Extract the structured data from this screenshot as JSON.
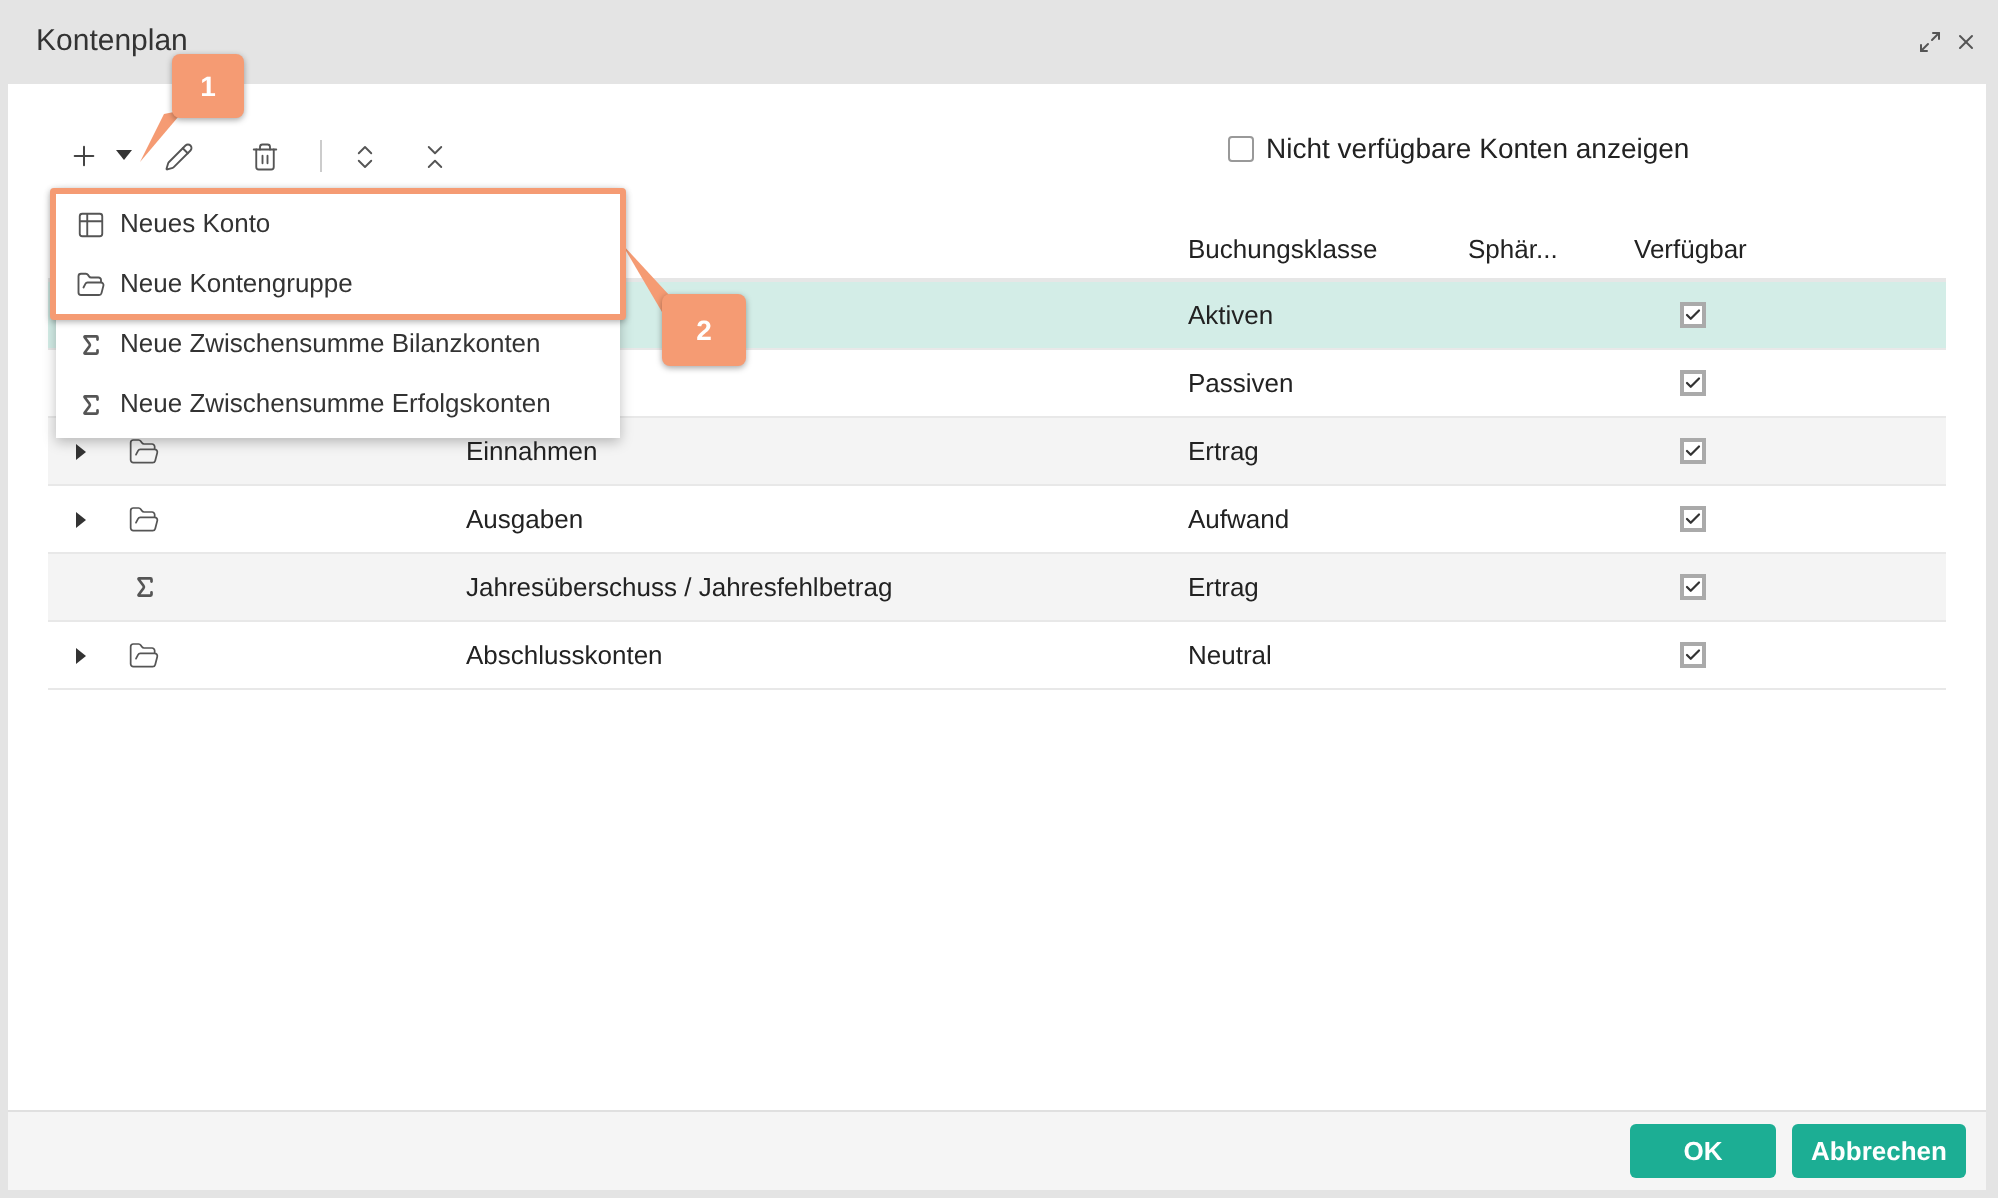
{
  "window": {
    "title": "Kontenplan"
  },
  "toolbar": {
    "show_unavailable": {
      "label": "Nicht verfügbare Konten anzeigen",
      "checked": false
    }
  },
  "add_menu": {
    "items": [
      {
        "label": "Neues Konto",
        "kind": "account",
        "highlighted": true
      },
      {
        "label": "Neue Kontengruppe",
        "kind": "group",
        "highlighted": true
      },
      {
        "label": "Neue Zwischensumme Bilanzkonten",
        "kind": "sum",
        "highlighted": false
      },
      {
        "label": "Neue Zwischensumme Erfolgskonten",
        "kind": "sum",
        "highlighted": false
      }
    ]
  },
  "callouts": [
    {
      "label": "1"
    },
    {
      "label": "2"
    }
  ],
  "table": {
    "columns": [
      "Buchungsklasse",
      "Sphär...",
      "Verfügbar"
    ],
    "rows": [
      {
        "selected": true,
        "class": "Aktiven",
        "available": true
      },
      {
        "selected": false,
        "class": "Passiven",
        "available": true
      },
      {
        "selected": false,
        "kind": "group",
        "expanded": false,
        "name": "Einnahmen",
        "class": "Ertrag",
        "available": true
      },
      {
        "selected": false,
        "kind": "group",
        "expanded": false,
        "name": "Ausgaben",
        "class": "Aufwand",
        "available": true
      },
      {
        "selected": false,
        "kind": "sum",
        "name": "Jahresüberschuss / Jahresfehlbetrag",
        "class": "Ertrag",
        "available": true
      },
      {
        "selected": false,
        "kind": "group",
        "expanded": false,
        "name": "Abschlusskonten",
        "class": "Neutral",
        "available": true
      }
    ]
  },
  "footer": {
    "buttons": [
      "OK",
      "Abbrechen"
    ]
  }
}
